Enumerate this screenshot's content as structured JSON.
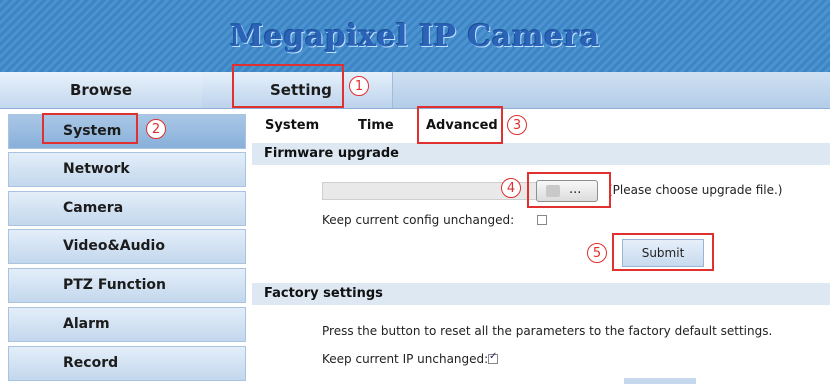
{
  "app": {
    "title": "Megapixel IP Camera"
  },
  "topnav": {
    "browse": "Browse",
    "setting": "Setting"
  },
  "sidebar": {
    "items": [
      "System",
      "Network",
      "Camera",
      "Video&Audio",
      "PTZ Function",
      "Alarm",
      "Record"
    ]
  },
  "subtabs": {
    "system": "System",
    "time": "Time",
    "advanced": "Advanced"
  },
  "firmware": {
    "title": "Firmware upgrade",
    "browse_label": "...",
    "hint": "(Please choose upgrade file.)",
    "keep_config_label": "Keep current config unchanged:",
    "keep_config_checked": false,
    "submit_label": "Submit"
  },
  "factory": {
    "title": "Factory settings",
    "description": "Press the button to reset all the parameters to the factory default settings.",
    "keep_ip_label": "Keep current IP unchanged:",
    "keep_ip_checked": true
  },
  "markers": [
    "1",
    "2",
    "3",
    "4",
    "5"
  ],
  "colors": {
    "banner": "#3d86c6",
    "marker": "#e03030",
    "section": "#dde8f3"
  }
}
